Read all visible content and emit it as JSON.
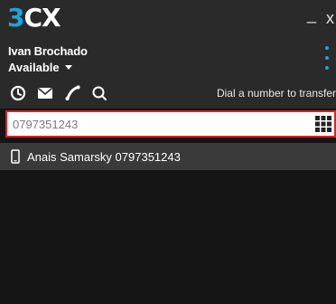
{
  "app": {
    "logo_number": "3",
    "logo_text": "CX"
  },
  "window": {
    "minimize_label": "_",
    "close_label": "x"
  },
  "user": {
    "name": "Ivan Brochado",
    "status": "Available"
  },
  "toolbar": {
    "icons": [
      "history-icon",
      "voicemail-icon",
      "call-icon",
      "search-icon"
    ],
    "dial_hint": "Dial a number to transfer"
  },
  "search": {
    "value": "0797351243",
    "placeholder": ""
  },
  "results": [
    {
      "name": "Anais Samarsky",
      "number": "0797351243"
    }
  ],
  "colors": {
    "accent": "#1fa3dd",
    "highlight_border": "#e02020",
    "background": "#151515",
    "panel": "#2a2a2a",
    "row": "#3a3a3a"
  }
}
